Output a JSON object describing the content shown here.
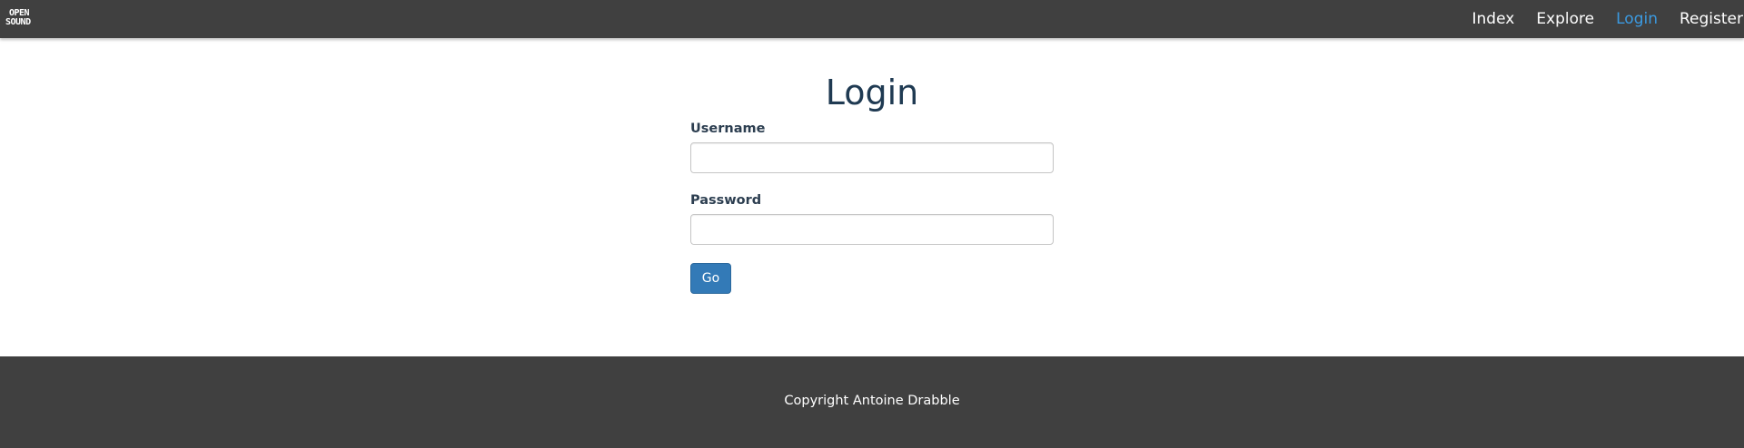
{
  "navbar": {
    "brand": {
      "line1": "OPEN",
      "line2": "SOUND"
    },
    "links": [
      {
        "label": "Index",
        "active": false
      },
      {
        "label": "Explore",
        "active": false
      },
      {
        "label": "Login",
        "active": true
      },
      {
        "label": "Register",
        "active": false
      }
    ],
    "background": "#404040",
    "active_color": "#3b9ae1"
  },
  "login": {
    "title": "Login",
    "username_label": "Username",
    "username_value": "",
    "password_label": "Password",
    "password_value": "",
    "submit_label": "Go",
    "button_color": "#337ab7"
  },
  "footer": {
    "text": "Copyright Antoine Drabble",
    "background": "#404040"
  }
}
